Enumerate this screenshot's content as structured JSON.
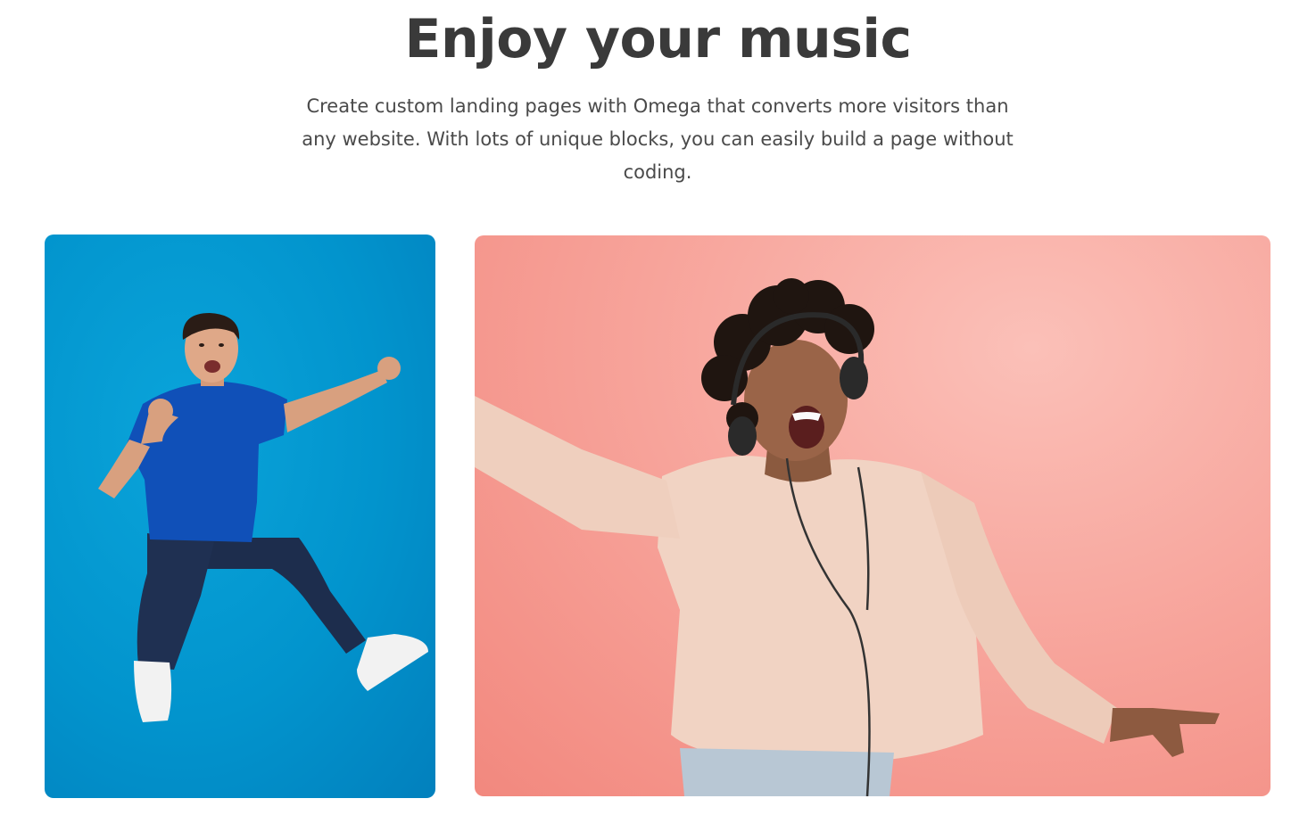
{
  "hero": {
    "title": "Enjoy your music",
    "description": "Create custom landing pages with Omega that converts more visitors than any website. With lots of unique blocks, you can easily build a page without coding."
  },
  "gallery": {
    "images": [
      {
        "subject": "man jumping in blue t-shirt",
        "background": "#0a9ad4"
      },
      {
        "subject": "woman dancing with headphones",
        "background": "#f7a39a"
      }
    ]
  }
}
